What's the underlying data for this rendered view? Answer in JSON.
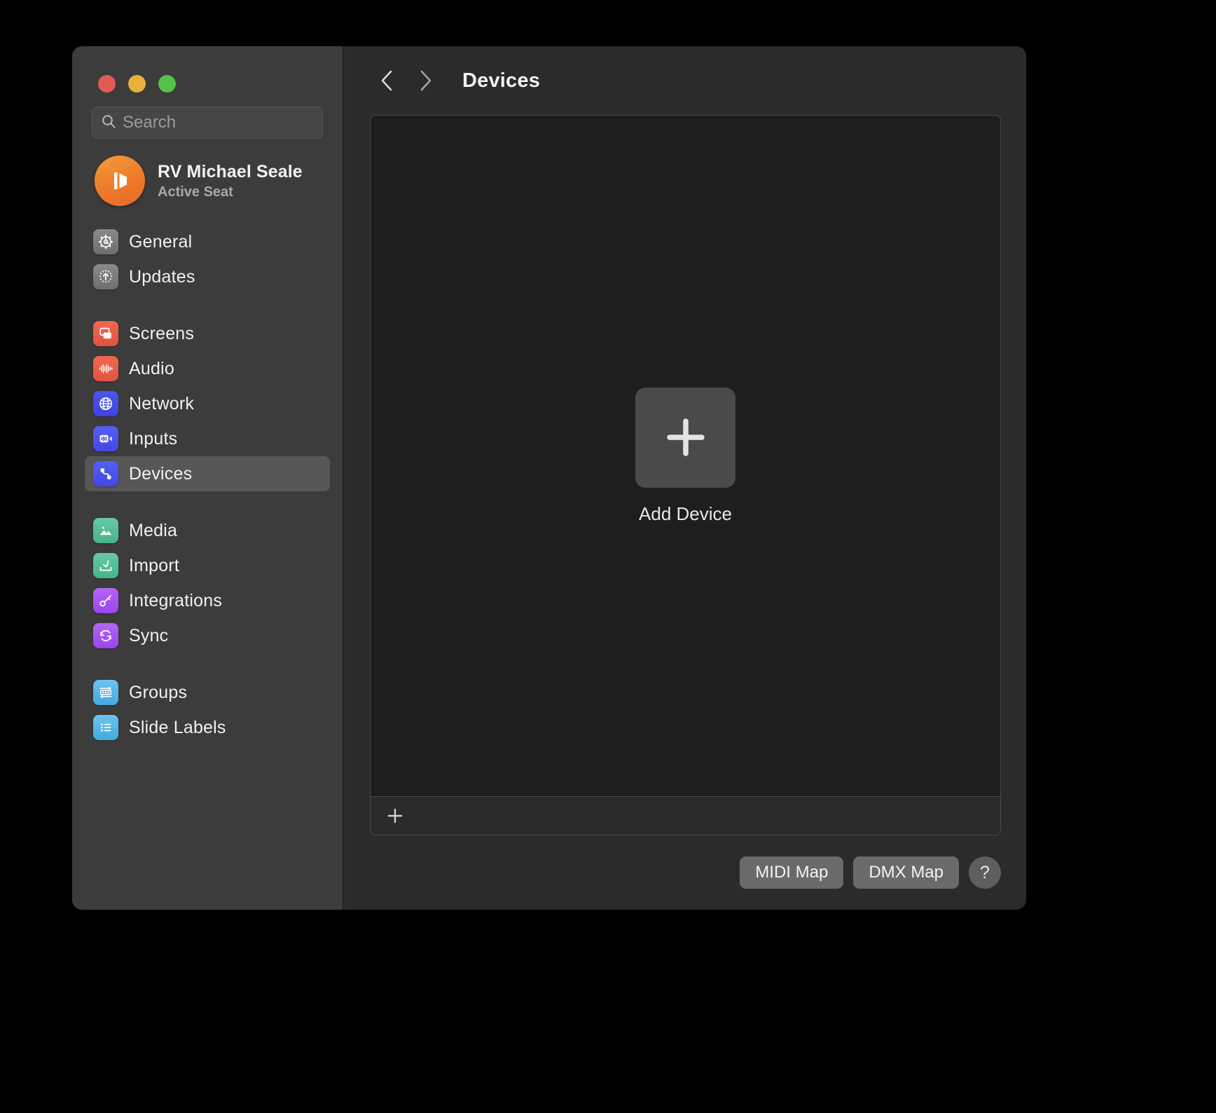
{
  "window": {
    "traffic_lights": [
      {
        "name": "close",
        "color": "#e05c52"
      },
      {
        "name": "minimize",
        "color": "#e8b13a"
      },
      {
        "name": "zoom",
        "color": "#56c14a"
      }
    ]
  },
  "search": {
    "placeholder": "Search",
    "value": "",
    "icon": "search-icon"
  },
  "profile": {
    "name": "RV Michael Seale",
    "status": "Active Seat",
    "avatar_icon": "propresenter-logo-icon",
    "avatar_color": "#ef7a2a"
  },
  "sidebar": {
    "groups": [
      {
        "items": [
          {
            "label": "General",
            "icon": "gear-icon",
            "color": "gray",
            "selected": false
          },
          {
            "label": "Updates",
            "icon": "arrow-up-circle-icon",
            "color": "gray",
            "selected": false
          }
        ]
      },
      {
        "items": [
          {
            "label": "Screens",
            "icon": "screens-icon",
            "color": "red",
            "selected": false
          },
          {
            "label": "Audio",
            "icon": "waveform-icon",
            "color": "red",
            "selected": false
          },
          {
            "label": "Network",
            "icon": "globe-icon",
            "color": "blue",
            "selected": false
          },
          {
            "label": "Inputs",
            "icon": "video-input-icon",
            "color": "indigo",
            "selected": false
          },
          {
            "label": "Devices",
            "icon": "devices-node-icon",
            "color": "indigo",
            "selected": true
          }
        ]
      },
      {
        "items": [
          {
            "label": "Media",
            "icon": "photo-icon",
            "color": "green",
            "selected": false
          },
          {
            "label": "Import",
            "icon": "import-tray-icon",
            "color": "green",
            "selected": false
          },
          {
            "label": "Integrations",
            "icon": "key-icon",
            "color": "purple",
            "selected": false
          },
          {
            "label": "Sync",
            "icon": "sync-arrows-icon",
            "color": "purple",
            "selected": false
          }
        ]
      },
      {
        "items": [
          {
            "label": "Groups",
            "icon": "groups-icon",
            "color": "cyan",
            "selected": false
          },
          {
            "label": "Slide Labels",
            "icon": "list-bullet-icon",
            "color": "cyan",
            "selected": false
          }
        ]
      }
    ]
  },
  "main": {
    "back_icon": "chevron-left-icon",
    "forward_icon": "chevron-right-icon",
    "title": "Devices",
    "empty_state": {
      "add_icon": "plus-icon",
      "add_label": "Add Device"
    },
    "panel_footer": {
      "add_icon": "plus-icon"
    }
  },
  "bottom_bar": {
    "midi_map_label": "MIDI Map",
    "dmx_map_label": "DMX Map",
    "help_label": "?"
  }
}
